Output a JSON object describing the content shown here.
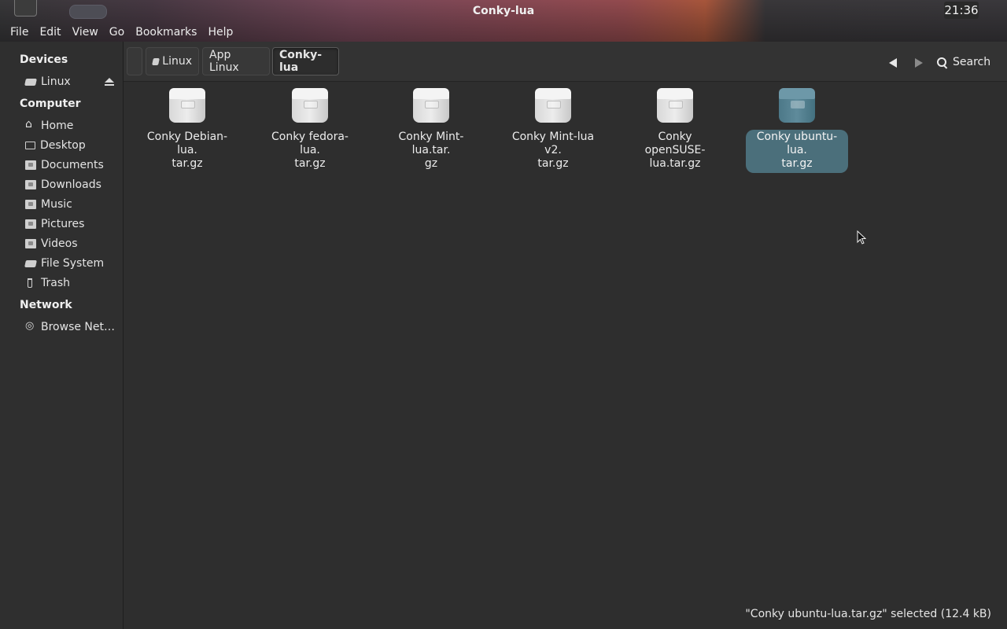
{
  "window": {
    "title": "Conky-lua",
    "clock": "21:36"
  },
  "menubar": {
    "items": [
      "File",
      "Edit",
      "View",
      "Go",
      "Bookmarks",
      "Help"
    ]
  },
  "sidebar": {
    "sections": [
      {
        "heading": "Devices",
        "items": [
          {
            "label": "Linux",
            "icon": "drive-icon"
          }
        ]
      },
      {
        "heading": "Computer",
        "items": [
          {
            "label": "Home",
            "icon": "home-icon"
          },
          {
            "label": "Desktop",
            "icon": "desktop-icon"
          },
          {
            "label": "Documents",
            "icon": "folder-icon"
          },
          {
            "label": "Downloads",
            "icon": "folder-icon"
          },
          {
            "label": "Music",
            "icon": "folder-icon"
          },
          {
            "label": "Pictures",
            "icon": "folder-icon"
          },
          {
            "label": "Videos",
            "icon": "folder-icon"
          },
          {
            "label": "File System",
            "icon": "drive-icon"
          },
          {
            "label": "Trash",
            "icon": "trash-icon"
          }
        ]
      },
      {
        "heading": "Network",
        "items": [
          {
            "label": "Browse Net…",
            "icon": "network-icon"
          }
        ]
      }
    ]
  },
  "toolbar": {
    "breadcrumbs": [
      "Linux",
      "App Linux",
      "Conky-lua"
    ],
    "search_label": "Search"
  },
  "files": [
    {
      "name": "Conky Debian-lua.\ntar.gz",
      "selected": false
    },
    {
      "name": "Conky fedora-lua.\ntar.gz",
      "selected": false
    },
    {
      "name": "Conky Mint-lua.tar.\ngz",
      "selected": false
    },
    {
      "name": "Conky Mint-lua v2.\ntar.gz",
      "selected": false
    },
    {
      "name": "Conky openSUSE-\nlua.tar.gz",
      "selected": false
    },
    {
      "name": "Conky ubuntu-lua.\ntar.gz",
      "selected": true
    }
  ],
  "status": {
    "text": "\"Conky ubuntu-lua.tar.gz\" selected (12.4 kB)"
  },
  "colors": {
    "background": "#2e2e2e",
    "selection": "#4b6f7b",
    "selected_icon": "#5f8b9b"
  }
}
